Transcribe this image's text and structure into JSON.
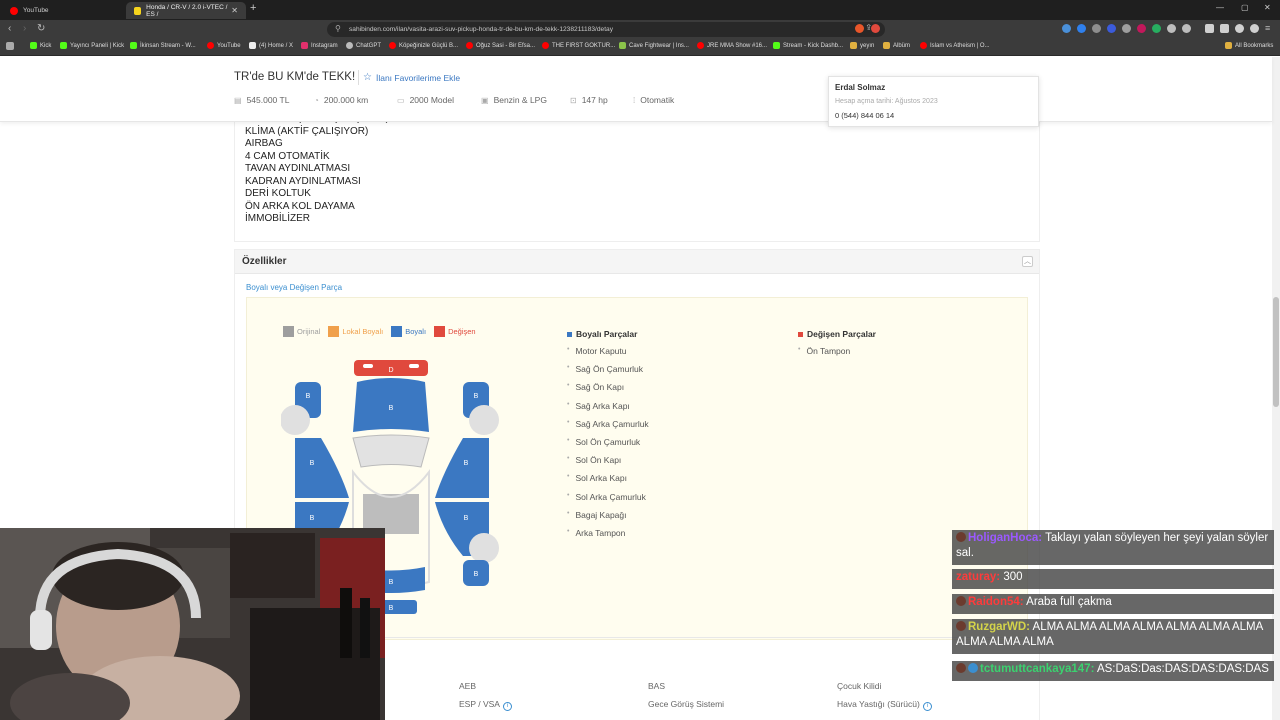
{
  "browser": {
    "tabs": [
      {
        "title": "YouTube"
      },
      {
        "title": "Honda / CR-V / 2.0 i-VTEC / ES /"
      }
    ],
    "url": "sahibinden.com/ilan/vasita-arazi-suv-pickup-honda-tr-de-bu-km-de-tekk-1238211183/detay",
    "bookmarks": [
      {
        "label": "Kick",
        "color": "#53fc18"
      },
      {
        "label": "Yayıncı Paneli | Kick",
        "color": "#53fc18"
      },
      {
        "label": "İkinsan Stream - W...",
        "color": "#53fc18"
      },
      {
        "label": "YouTube",
        "color": "#ff0000"
      },
      {
        "label": "(4) Home / X",
        "color": "#eeeeee"
      },
      {
        "label": "Instagram",
        "color": "#e1306c"
      },
      {
        "label": "ChatGPT",
        "color": "#bbbbbb"
      },
      {
        "label": "Köpeğinizle Güçlü B...",
        "color": "#ff0000"
      },
      {
        "label": "Oğuz Sasi - Bir Efsa...",
        "color": "#ff0000"
      },
      {
        "label": "THE FIRST GOKTUR...",
        "color": "#ff0000"
      },
      {
        "label": "Cave Fightwear | Ins...",
        "color": "#8bc34a"
      },
      {
        "label": "JRE MMA Show #16...",
        "color": "#ff0000"
      },
      {
        "label": "Stream - Kick Dashb...",
        "color": "#53fc18"
      },
      {
        "label": "yeyın",
        "color": "#e0b040"
      },
      {
        "label": "Albüm",
        "color": "#e0b040"
      },
      {
        "label": "Islam vs Atheism | O...",
        "color": "#ff0000"
      }
    ],
    "all_bookmarks": "All Bookmarks"
  },
  "listing": {
    "title": "TR'de BU KM'de TEKK!",
    "favorite_label": "İlanı Favorilerime Ekle",
    "specs": [
      {
        "icon": "price-icon",
        "value": "545.000 TL"
      },
      {
        "icon": "odometer-icon",
        "value": "200.000 km"
      },
      {
        "icon": "calendar-icon",
        "value": "2000 Model"
      },
      {
        "icon": "fuel-icon",
        "value": "Benzin & LPG"
      },
      {
        "icon": "engine-icon",
        "value": "147 hp"
      },
      {
        "icon": "gearbox-icon",
        "value": "Otomatik"
      }
    ]
  },
  "seller": {
    "name": "Erdal Solmaz",
    "since": "Hesap açma tarihi: Ağustos 2023",
    "phone": "0 (544) 844 06 14"
  },
  "description_lines": [
    "SUNROOF (AKTİF ÇALIŞIYOR)",
    "KLİMA (AKTİF ÇALIŞIYOR)",
    "AIRBAG",
    "4 CAM OTOMATİK",
    "TAVAN AYDINLATMASI",
    "KADRAN AYDINLATMASI",
    "DERİ KOLTUK",
    "ÖN ARKA KOL DAYAMA",
    "İMMOBİLİZER"
  ],
  "features": {
    "title": "Özellikler",
    "paint_section_label": "Boyalı veya Değişen Parça",
    "legend": [
      {
        "label": "Orijinal",
        "color": "#9e9e9e"
      },
      {
        "label": "Lokal Boyalı",
        "color": "#f0a04b"
      },
      {
        "label": "Boyalı",
        "color": "#3b78c2"
      },
      {
        "label": "Değişen",
        "color": "#e0493d"
      }
    ],
    "diagram": {
      "painted_mark": "B",
      "changed_mark": "D"
    },
    "painted_parts": {
      "title": "Boyalı Parçalar",
      "color": "#3b78c2",
      "items": [
        "Motor Kaputu",
        "Sağ Ön Çamurluk",
        "Sağ Ön Kapı",
        "Sağ Arka Kapı",
        "Sağ Arka Çamurluk",
        "Sol Ön Çamurluk",
        "Sol Ön Kapı",
        "Sol Arka Kapı",
        "Sol Arka Çamurluk",
        "Bagaj Kapağı",
        "Arka Tampon"
      ]
    },
    "changed_parts": {
      "title": "Değişen Parçalar",
      "color": "#e0493d",
      "items": [
        "Ön Tampon"
      ]
    }
  },
  "equipment": [
    {
      "label": "AEB",
      "info": false
    },
    {
      "label": "ESP / VSA",
      "info": true
    },
    {
      "label": "BAS",
      "info": false
    },
    {
      "label": "Gece Görüş Sistemi",
      "info": false
    },
    {
      "label": "Çocuk Kilidi",
      "info": false
    },
    {
      "label": "Hava Yastığı (Sürücü)",
      "info": true
    }
  ],
  "chat": [
    {
      "user": "HoliganHoca:",
      "user_color": "#9b59ff",
      "message": "Taklayı yalan söyleyen her şeyi yalan söyler sal."
    },
    {
      "user": "zaturay:",
      "user_color": "#ff3b3b",
      "message": "300"
    },
    {
      "user": "Raidon54:",
      "user_color": "#ff3b3b",
      "message": "Araba full çakma"
    },
    {
      "user": "RuzgarWD:",
      "user_color": "#d4d44a",
      "message": "ALMA ALMA ALMA ALMA ALMA ALMA ALMA ALMA ALMA ALMA"
    },
    {
      "user": "tctumuttcankaya147:",
      "user_color": "#3bd16f",
      "message": "AS:DaS:Das:DAS:DAS:DAS:DAS"
    }
  ]
}
